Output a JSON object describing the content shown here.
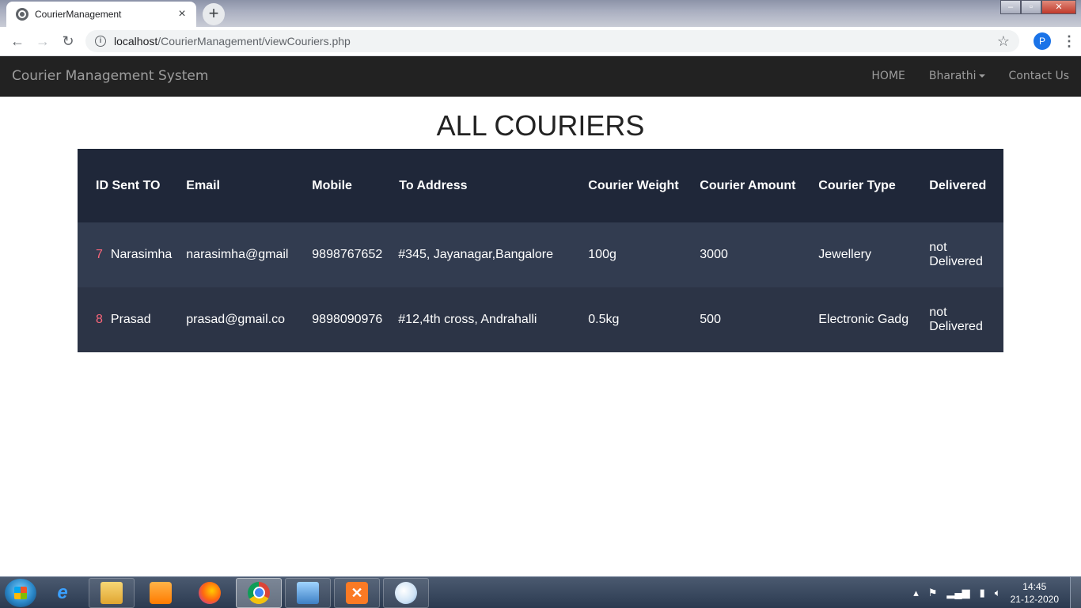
{
  "browser": {
    "tab_title": "CourierManagement",
    "tab_close": "×",
    "new_tab": "+",
    "url_host": "localhost",
    "url_path": "/CourierManagement/viewCouriers.php",
    "profile_initial": "P"
  },
  "navbar": {
    "brand": "Courier Management System",
    "links": {
      "home": "HOME",
      "user": "Bharathi",
      "contact": "Contact Us"
    }
  },
  "page": {
    "heading": "ALL COURIERS"
  },
  "table": {
    "headers": [
      "ID Sent TO",
      "Email",
      "Mobile",
      "To Address",
      "Courier Weight",
      "Courier Amount",
      "Courier Type",
      "Delivered"
    ],
    "rows": [
      {
        "id": "7",
        "sent_to": "Narasimha",
        "email": "narasimha@gmail",
        "mobile": "9898767652",
        "address": "#345, Jayanagar,Bangalore",
        "weight": "100g",
        "amount": "3000",
        "type": "Jewellery",
        "delivered_line1": "not",
        "delivered_line2": "Delivered"
      },
      {
        "id": "8",
        "sent_to": "Prasad",
        "email": "prasad@gmail.co",
        "mobile": "9898090976",
        "address": "#12,4th cross, Andrahalli",
        "weight": "0.5kg",
        "amount": "500",
        "type": "Electronic Gadg",
        "delivered_line1": "not",
        "delivered_line2": "Delivered"
      }
    ]
  },
  "taskbar": {
    "time": "14:45",
    "date": "21-12-2020",
    "xampp_glyph": "✕"
  },
  "colors": {
    "navbar_bg": "#222222",
    "table_header_bg": "#1f2739",
    "row_bg": "#323c50",
    "id_accent": "#fb667a"
  }
}
